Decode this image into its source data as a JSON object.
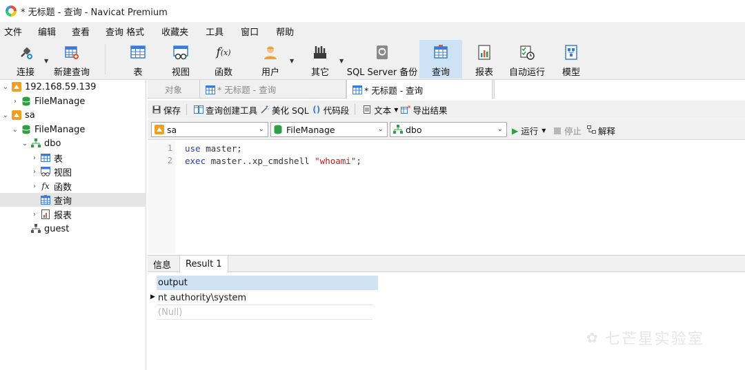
{
  "window": {
    "title": "* 无标题 - 查询 - Navicat Premium"
  },
  "menu": [
    "文件",
    "编辑",
    "查看",
    "查询",
    "格式",
    "收藏夹",
    "工具",
    "窗口",
    "帮助"
  ],
  "toolbar": {
    "connect": "连接",
    "new_query": "新建查询",
    "table": "表",
    "view": "视图",
    "function": "函数",
    "user": "用户",
    "other": "其它",
    "backup": "SQL Server 备份",
    "query": "查询",
    "report": "报表",
    "automation": "自动运行",
    "model": "模型"
  },
  "tree": {
    "server": "192.168.59.139",
    "server_db": "FileManage",
    "conn": "sa",
    "conn_db": "FileManage",
    "schema": "dbo",
    "tables": "表",
    "views": "视图",
    "functions": "函数",
    "queries": "查询",
    "reports": "报表",
    "guest": "guest"
  },
  "tabs": {
    "objects": "对象",
    "tab1": "* 无标题 - 查询",
    "tab2": "* 无标题 - 查询"
  },
  "query_toolbar": {
    "save": "保存",
    "builder": "查询创建工具",
    "beautify": "美化 SQL",
    "snippet": "代码段",
    "text": "文本",
    "export": "导出结果"
  },
  "selectors": {
    "connection": "sa",
    "database": "FileManage",
    "schema": "dbo",
    "run": "运行",
    "stop": "停止",
    "explain": "解释"
  },
  "editor": {
    "line1_no": "1",
    "line1_kw": "use",
    "line1_rest": " master;",
    "line2_no": "2",
    "line2_kw": "exec",
    "line2_mid": " master..xp_cmdshell ",
    "line2_str": "\"whoami\"",
    "line2_end": ";"
  },
  "result_tabs": {
    "info": "信息",
    "result": "Result 1"
  },
  "grid": {
    "column": "output",
    "row1": "nt authority\\system",
    "row2": "(Null)"
  },
  "watermark": "七芒星实验室",
  "colors": {
    "accent": "#cde3f5",
    "keyword": "#1f3fbf",
    "string": "#c41a16"
  }
}
